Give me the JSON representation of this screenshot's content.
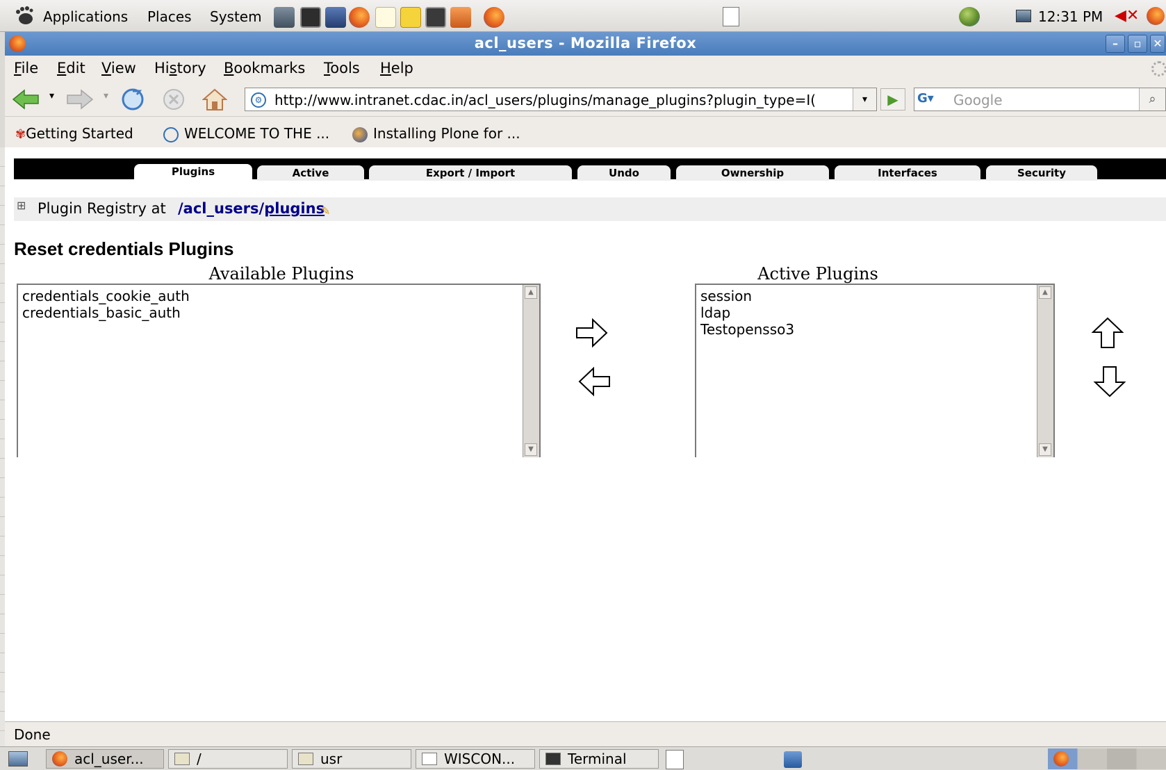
{
  "top_panel": {
    "menus": [
      "Applications",
      "Places",
      "System"
    ],
    "clock": "12:31 PM"
  },
  "window": {
    "title": "acl_users - Mozilla Firefox",
    "minimize": "–",
    "maximize": "▫",
    "close": "✕"
  },
  "menubar": {
    "items": [
      {
        "label": "File",
        "accel": "F",
        "rest": "ile"
      },
      {
        "label": "Edit",
        "accel": "E",
        "rest": "dit"
      },
      {
        "label": "View",
        "accel": "V",
        "rest": "iew"
      },
      {
        "label": "History",
        "pre": "Hi",
        "accel": "s",
        "rest": "tory"
      },
      {
        "label": "Bookmarks",
        "accel": "B",
        "rest": "ookmarks"
      },
      {
        "label": "Tools",
        "accel": "T",
        "rest": "ools"
      },
      {
        "label": "Help",
        "accel": "H",
        "rest": "elp"
      }
    ]
  },
  "navbar": {
    "url": "http://www.intranet.cdac.in/acl_users/plugins/manage_plugins?plugin_type=I(",
    "search_placeholder": "Google"
  },
  "bookmarks": {
    "items": [
      "Getting Started",
      "WELCOME TO THE ...",
      "Installing Plone for ..."
    ]
  },
  "zmi": {
    "tabs": [
      "Plugins",
      "Active",
      "Export / Import",
      "Undo",
      "Ownership",
      "Interfaces",
      "Security"
    ],
    "active_tab": "Plugins",
    "registry_prefix": "Plugin Registry at",
    "registry_path": "/acl_users/",
    "registry_link": "plugins",
    "page_title": "Reset credentials Plugins",
    "available_caption": "Available Plugins",
    "available_plugins": [
      "credentials_cookie_auth",
      "credentials_basic_auth"
    ],
    "active_caption": "Active Plugins",
    "active_plugins": [
      "session",
      "ldap",
      "Testopensso3"
    ]
  },
  "statusbar": {
    "text": "Done"
  },
  "taskbar": {
    "tasks": [
      "acl_user...",
      "/",
      "usr",
      "WISCON...",
      "Terminal"
    ]
  },
  "colors": {
    "titlebar": "#4a7cbc",
    "link": "#00008b",
    "tab_strip": "#000000"
  }
}
